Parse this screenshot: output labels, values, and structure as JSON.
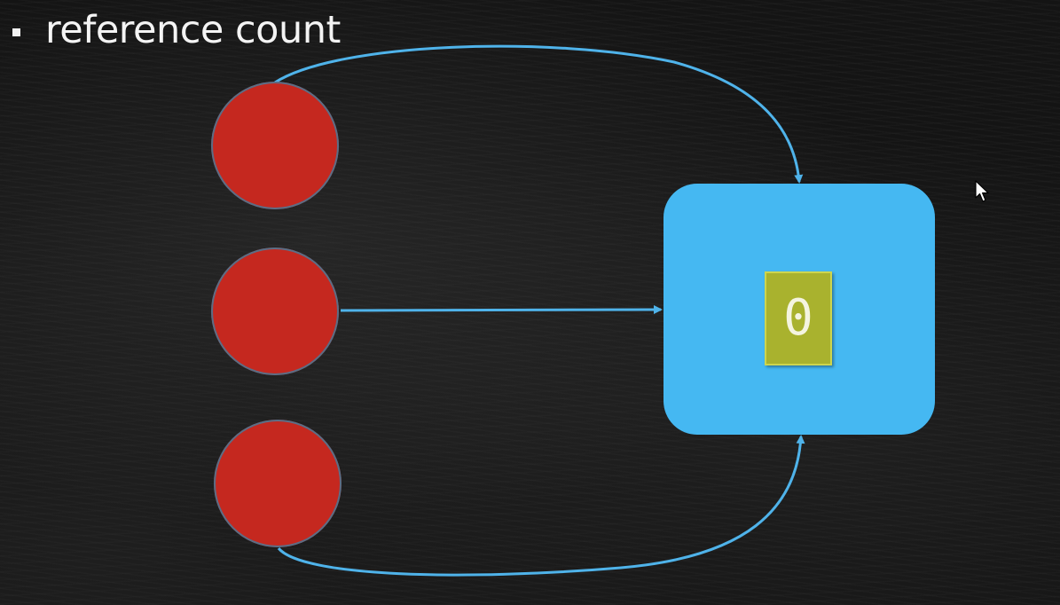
{
  "slide": {
    "title": "reference count"
  },
  "diagram": {
    "referrers": [
      {
        "id": "ref-1"
      },
      {
        "id": "ref-2"
      },
      {
        "id": "ref-3"
      }
    ],
    "target": {
      "count": "0"
    }
  },
  "colors": {
    "background": "#141414",
    "title": "#f4f4f4",
    "referrer": "#c5281f",
    "target": "#45b8f2",
    "counter": "#a9b22e",
    "arrow": "#4fb3ea"
  },
  "icons": {
    "bullet": "square-bullet-icon",
    "cursor": "mouse-pointer-icon"
  }
}
